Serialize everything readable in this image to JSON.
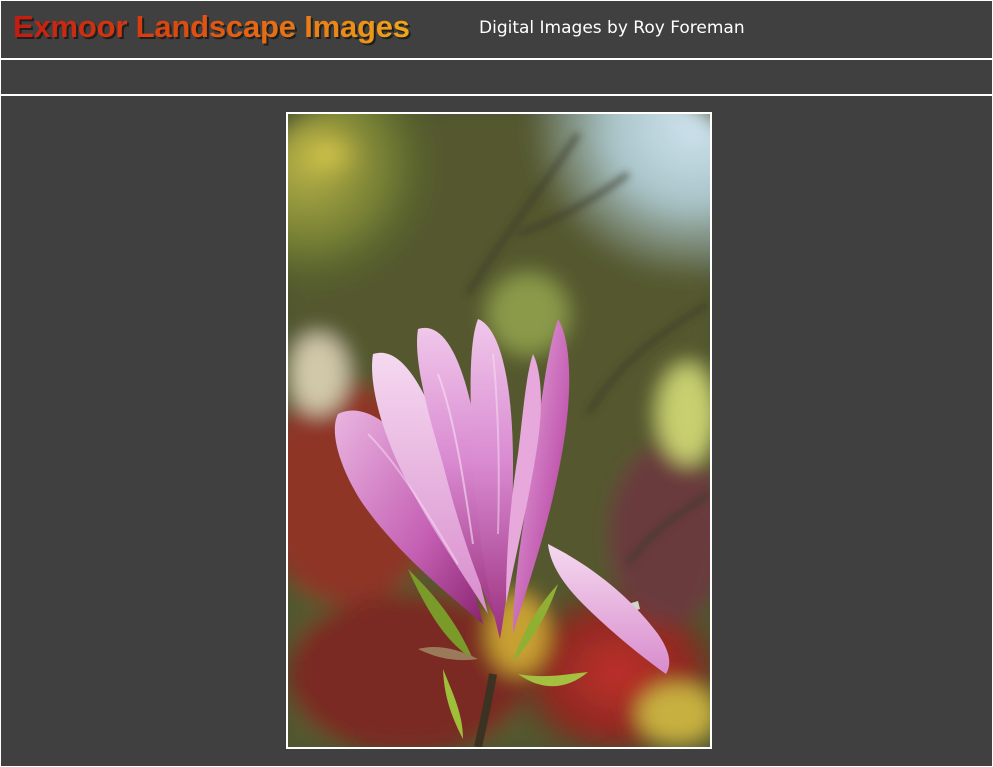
{
  "header": {
    "site_title": "Exmoor Landscape Images",
    "site_subtitle": "Digital Images by Roy Foreman"
  },
  "photo": {
    "subject": "pink-magnolia-flower"
  },
  "colors": {
    "background": "#404040",
    "border": "#ffffff",
    "title_gradient_start": "#c41b10",
    "title_gradient_end": "#f0a619",
    "subtitle": "#ffffff"
  }
}
